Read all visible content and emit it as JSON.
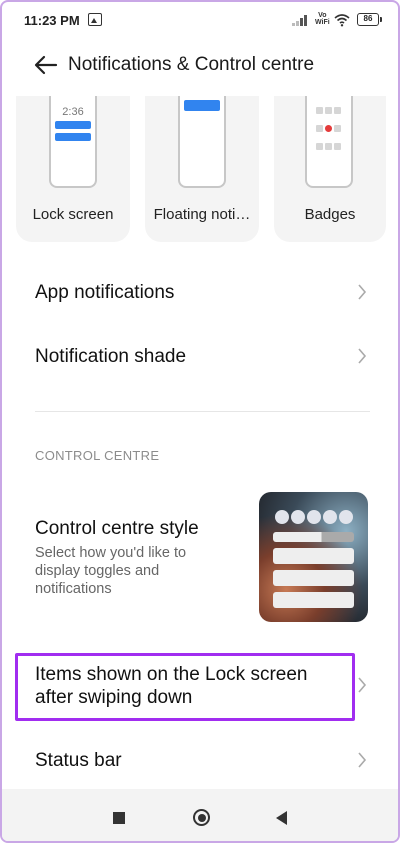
{
  "status_bar": {
    "time": "11:23 PM",
    "network_line1": "Vo",
    "network_line2": "WiFi",
    "battery": "86"
  },
  "header": {
    "title": "Notifications & Control centre"
  },
  "cards": [
    {
      "label": "Lock screen",
      "preview_clock": "2:36"
    },
    {
      "label": "Floating noti…"
    },
    {
      "label": "Badges"
    }
  ],
  "list": {
    "app_notifications": "App notifications",
    "notification_shade": "Notification shade"
  },
  "section": {
    "title": "CONTROL CENTRE"
  },
  "control_centre_style": {
    "title": "Control centre style",
    "subtitle": "Select how you'd like to display toggles and notifications"
  },
  "items_lock_screen": {
    "line1": "Items shown on the Lock screen",
    "line2": "after swiping down"
  },
  "status_bar_item": {
    "title": "Status bar"
  },
  "colors": {
    "accent_blue": "#3184ef",
    "highlight_purple": "#a12df0",
    "badge_red": "#e43b3b"
  },
  "icons": [
    "back-arrow-icon",
    "chevron-right-icon",
    "wifi-icon",
    "battery-icon",
    "signal-icon",
    "recents-square-icon",
    "home-circle-icon",
    "back-triangle-icon"
  ]
}
